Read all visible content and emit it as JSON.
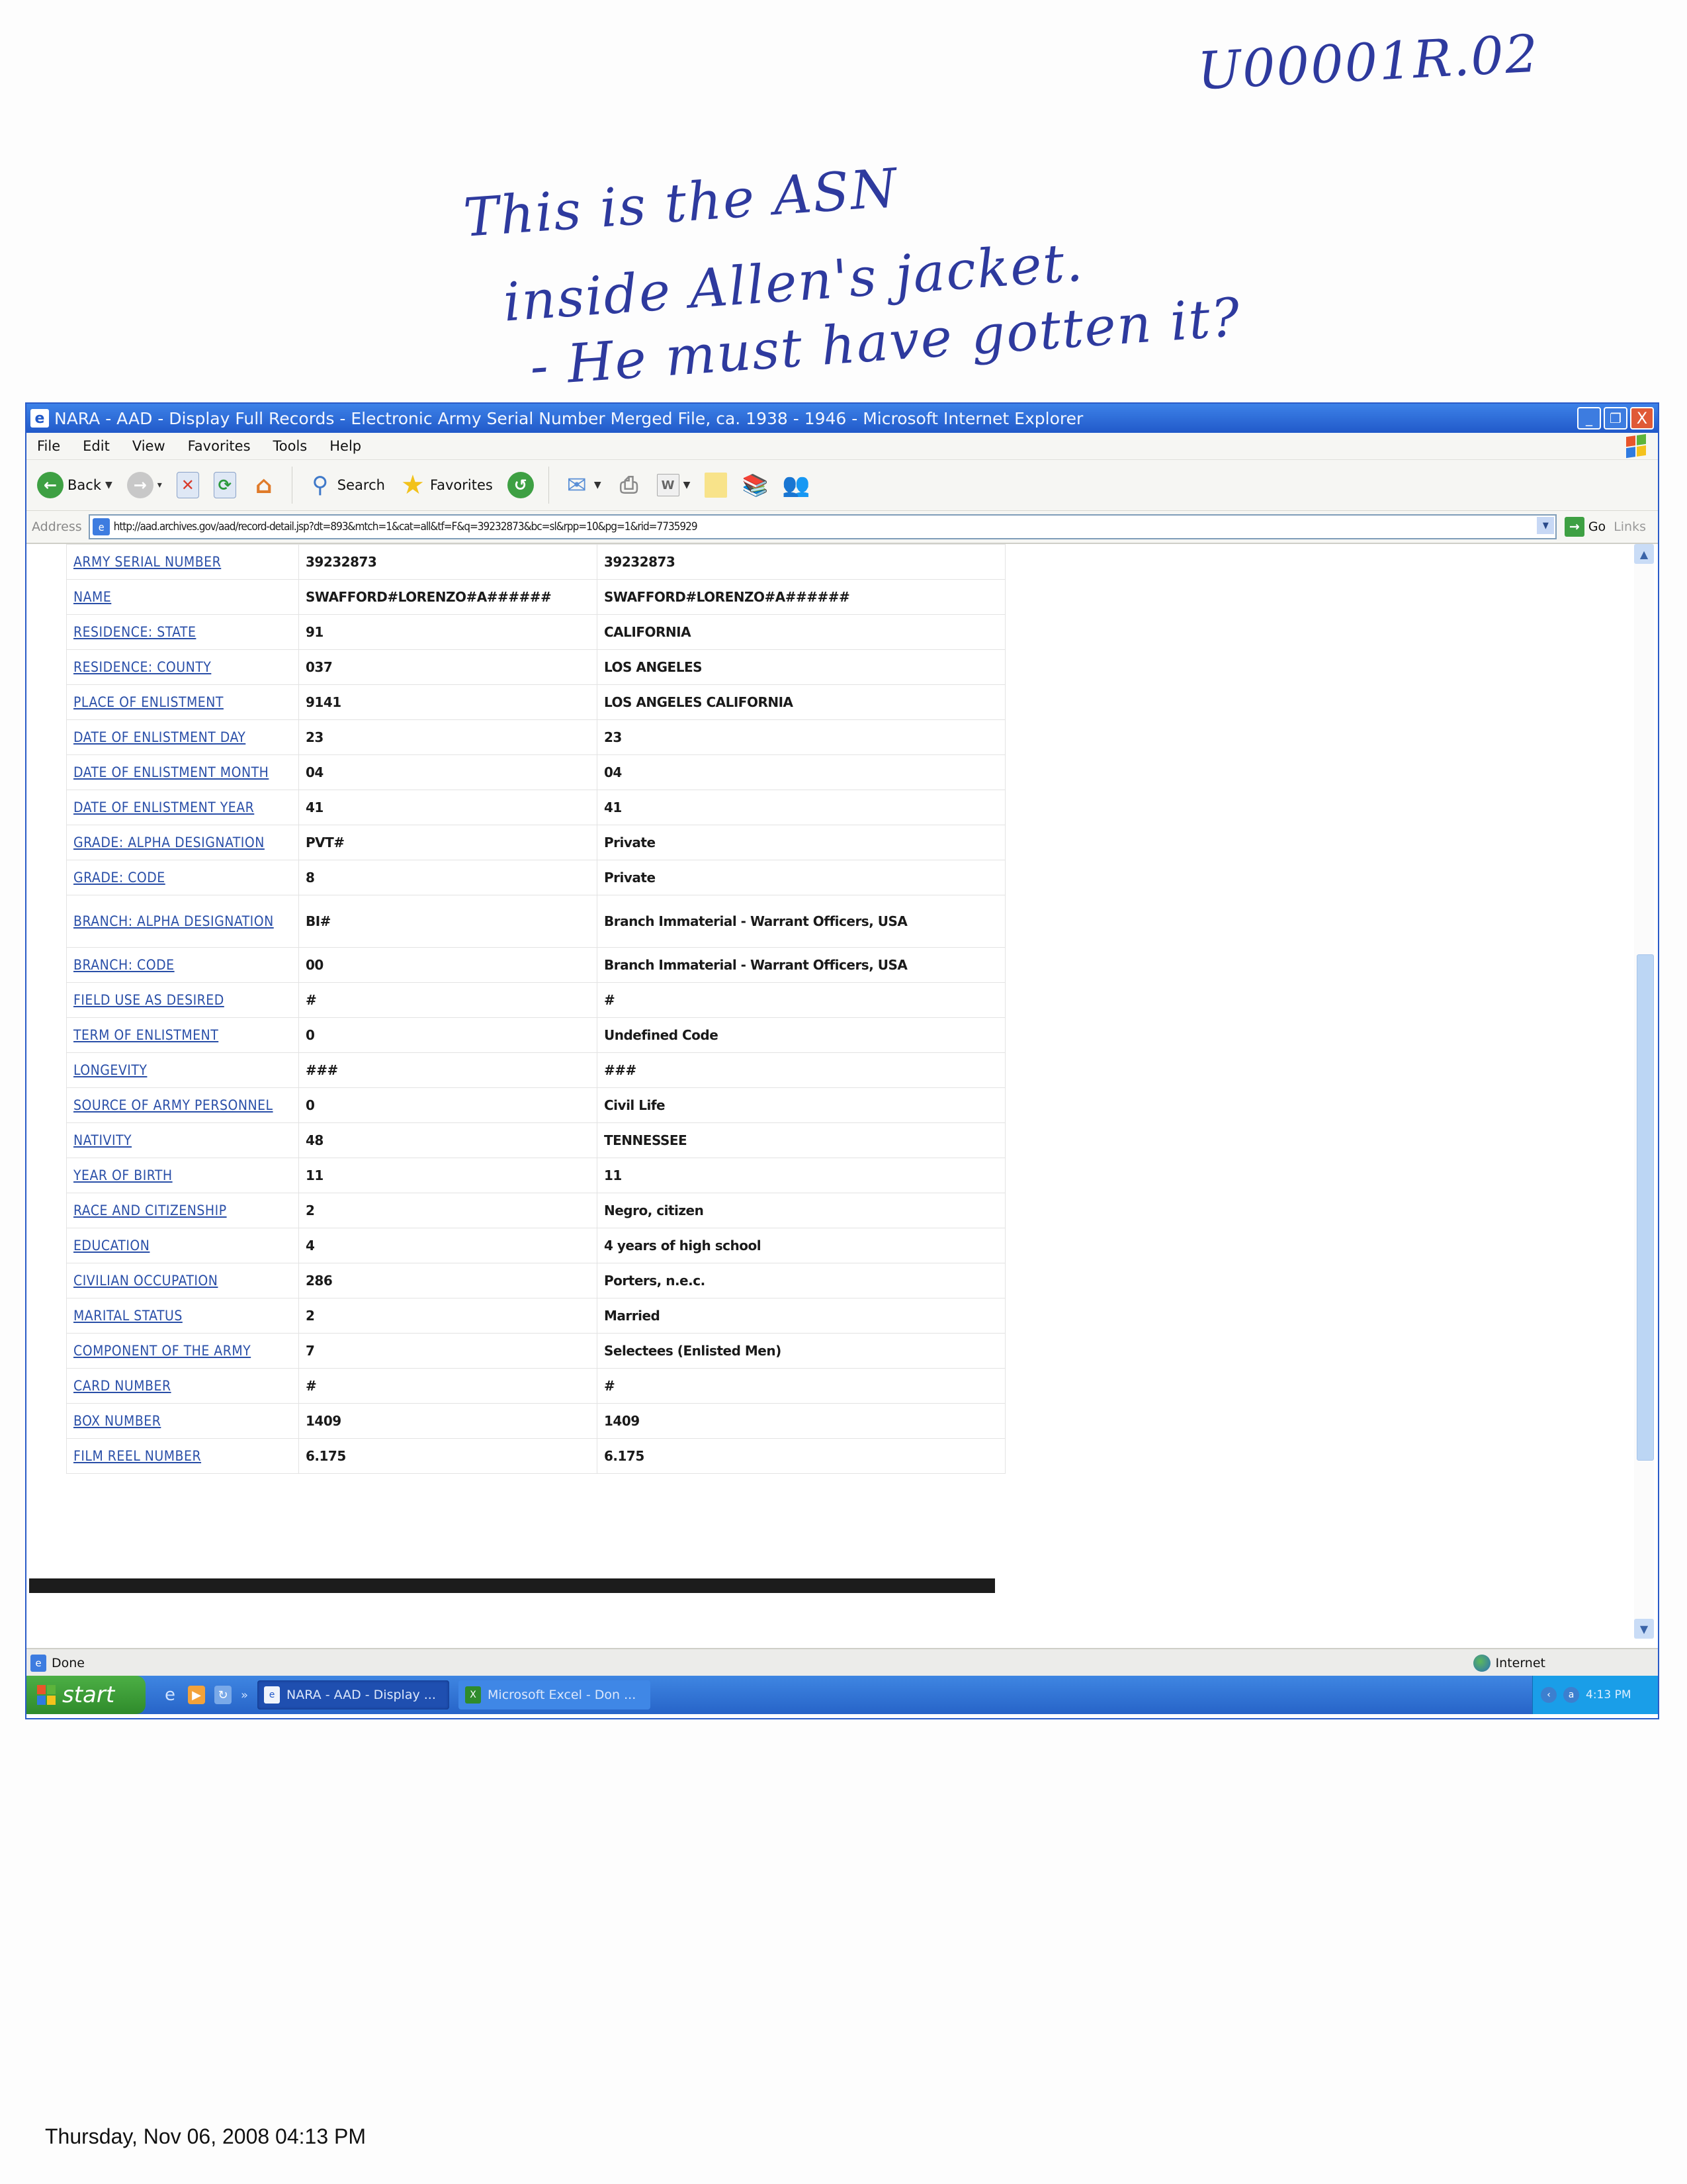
{
  "annotations": {
    "doc_id": "U00001R.02",
    "note_lines": [
      "This is the ASN",
      "inside Allen's jacket.",
      "- He must have gotten it?"
    ]
  },
  "window": {
    "title": "NARA - AAD - Display Full Records - Electronic Army Serial Number Merged File, ca. 1938 - 1946 - Microsoft Internet Explorer",
    "controls": {
      "minimize": "_",
      "restore": "❐",
      "close": "X"
    }
  },
  "menu": [
    "File",
    "Edit",
    "View",
    "Favorites",
    "Tools",
    "Help"
  ],
  "toolbar": {
    "back_label": "Back",
    "search_label": "Search",
    "favorites_label": "Favorites"
  },
  "address": {
    "label": "Address",
    "url": "http://aad.archives.gov/aad/record-detail.jsp?dt=893&mtch=1&cat=all&tf=F&q=39232873&bc=sl&rpp=10&pg=1&rid=7735929",
    "go_label": "Go",
    "links_label": "Links"
  },
  "record": {
    "rows": [
      {
        "field": "ARMY SERIAL NUMBER",
        "code": "39232873",
        "meaning": "39232873"
      },
      {
        "field": "NAME",
        "code": "SWAFFORD#LORENZO#A######",
        "meaning": "SWAFFORD#LORENZO#A######"
      },
      {
        "field": "RESIDENCE: STATE",
        "code": "91",
        "meaning": "CALIFORNIA"
      },
      {
        "field": "RESIDENCE: COUNTY",
        "code": "037",
        "meaning": "LOS ANGELES"
      },
      {
        "field": "PLACE OF ENLISTMENT",
        "code": "9141",
        "meaning": "LOS ANGELES CALIFORNIA"
      },
      {
        "field": "DATE OF ENLISTMENT DAY",
        "code": "23",
        "meaning": "23"
      },
      {
        "field": "DATE OF ENLISTMENT MONTH",
        "code": "04",
        "meaning": "04"
      },
      {
        "field": "DATE OF ENLISTMENT YEAR",
        "code": "41",
        "meaning": "41"
      },
      {
        "field": "GRADE: ALPHA DESIGNATION",
        "code": "PVT#",
        "meaning": "Private"
      },
      {
        "field": "GRADE: CODE",
        "code": "8",
        "meaning": "Private"
      },
      {
        "field": "BRANCH: ALPHA DESIGNATION",
        "code": "BI#",
        "meaning": "Branch Immaterial - Warrant Officers, USA"
      },
      {
        "field": "BRANCH: CODE",
        "code": "00",
        "meaning": "Branch Immaterial - Warrant Officers, USA"
      },
      {
        "field": "FIELD USE AS DESIRED",
        "code": "#",
        "meaning": "#"
      },
      {
        "field": "TERM OF ENLISTMENT",
        "code": "0",
        "meaning": "Undefined Code"
      },
      {
        "field": "LONGEVITY",
        "code": "###",
        "meaning": "###"
      },
      {
        "field": "SOURCE OF ARMY PERSONNEL",
        "code": "0",
        "meaning": "Civil Life"
      },
      {
        "field": "NATIVITY",
        "code": "48",
        "meaning": "TENNESSEE"
      },
      {
        "field": "YEAR OF BIRTH",
        "code": "11",
        "meaning": "11"
      },
      {
        "field": "RACE AND CITIZENSHIP",
        "code": "2",
        "meaning": "Negro, citizen"
      },
      {
        "field": "EDUCATION",
        "code": "4",
        "meaning": "4 years of high school"
      },
      {
        "field": "CIVILIAN OCCUPATION",
        "code": "286",
        "meaning": "Porters, n.e.c."
      },
      {
        "field": "MARITAL STATUS",
        "code": "2",
        "meaning": "Married"
      },
      {
        "field": "COMPONENT OF THE ARMY",
        "code": "7",
        "meaning": "Selectees (Enlisted Men)"
      },
      {
        "field": "CARD NUMBER",
        "code": "#",
        "meaning": "#"
      },
      {
        "field": "BOX NUMBER",
        "code": "1409",
        "meaning": "1409"
      },
      {
        "field": "FILM REEL NUMBER",
        "code": "6.175",
        "meaning": "6.175"
      }
    ]
  },
  "scrollbar": {
    "thumb_start_fraction": 0.37,
    "thumb_end_fraction": 0.85
  },
  "status": {
    "text": "Done",
    "zone": "Internet"
  },
  "taskbar": {
    "start_label": "start",
    "tasks": [
      {
        "label": "NARA - AAD - Display ...",
        "active": true,
        "icon": "ie-icon"
      },
      {
        "label": "Microsoft Excel - Don ...",
        "active": false,
        "icon": "excel-icon"
      }
    ],
    "clock": "4:13 PM"
  },
  "print_footer": "Thursday, Nov 06, 2008  04:13 PM"
}
